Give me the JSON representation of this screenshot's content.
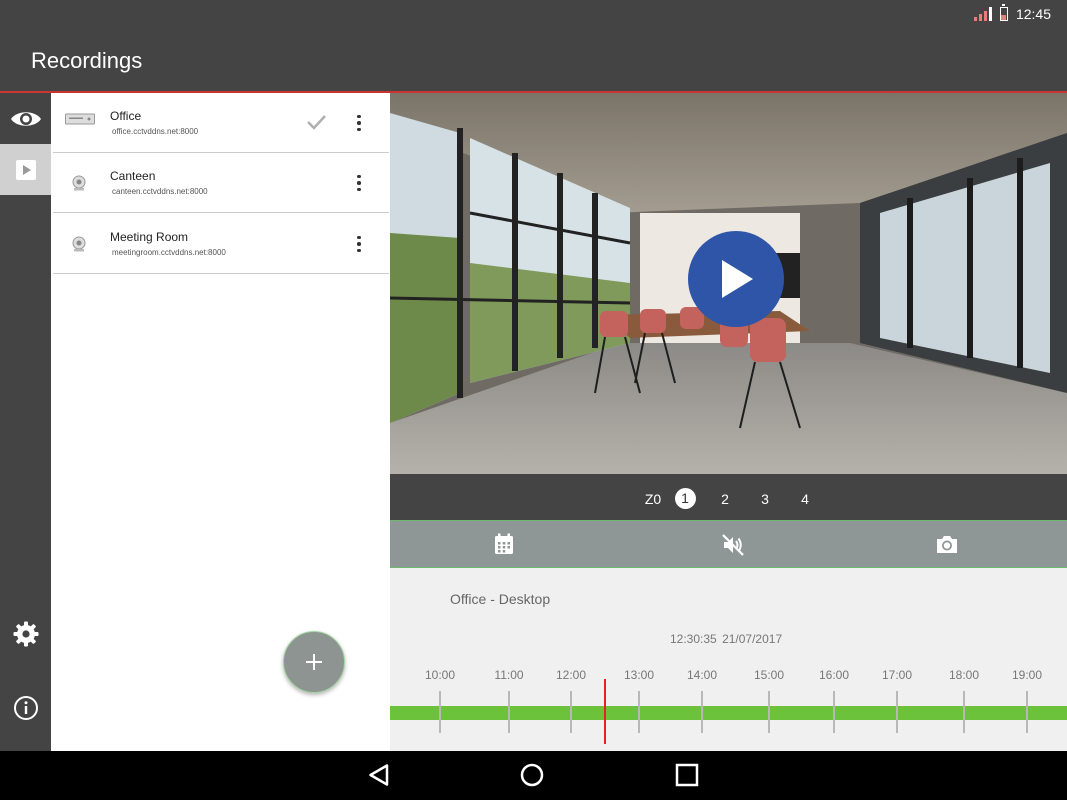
{
  "status_bar": {
    "time": "12:45"
  },
  "app_bar": {
    "title": "Recordings"
  },
  "devices": [
    {
      "name": "Office",
      "address": "office.cctvddns.net:8000",
      "selected": true,
      "icon": "dvr-icon"
    },
    {
      "name": "Canteen",
      "address": "canteen.cctvddns.net:8000",
      "selected": false,
      "icon": "webcam-icon"
    },
    {
      "name": "Meeting Room",
      "address": "meetingroom.cctvddns.net:8000",
      "selected": false,
      "icon": "webcam-icon"
    }
  ],
  "zone_bar": {
    "zoom_label": "Z0",
    "zones": [
      "1",
      "2",
      "3",
      "4"
    ],
    "selected_zone": "1"
  },
  "timeline": {
    "camera_label": "Office - Desktop",
    "current_time": "12:30:35",
    "current_date": "21/07/2017",
    "ticks": [
      "10:00",
      "11:00",
      "12:00",
      "13:00",
      "14:00",
      "15:00",
      "16:00",
      "17:00",
      "18:00",
      "19:00"
    ]
  },
  "colors": {
    "accent_red": "#cc3333",
    "play_blue": "#2f55a8",
    "timeline_green": "#6cc23a",
    "toolbar_gray": "#8f9796",
    "playhead_red": "#e52222"
  }
}
